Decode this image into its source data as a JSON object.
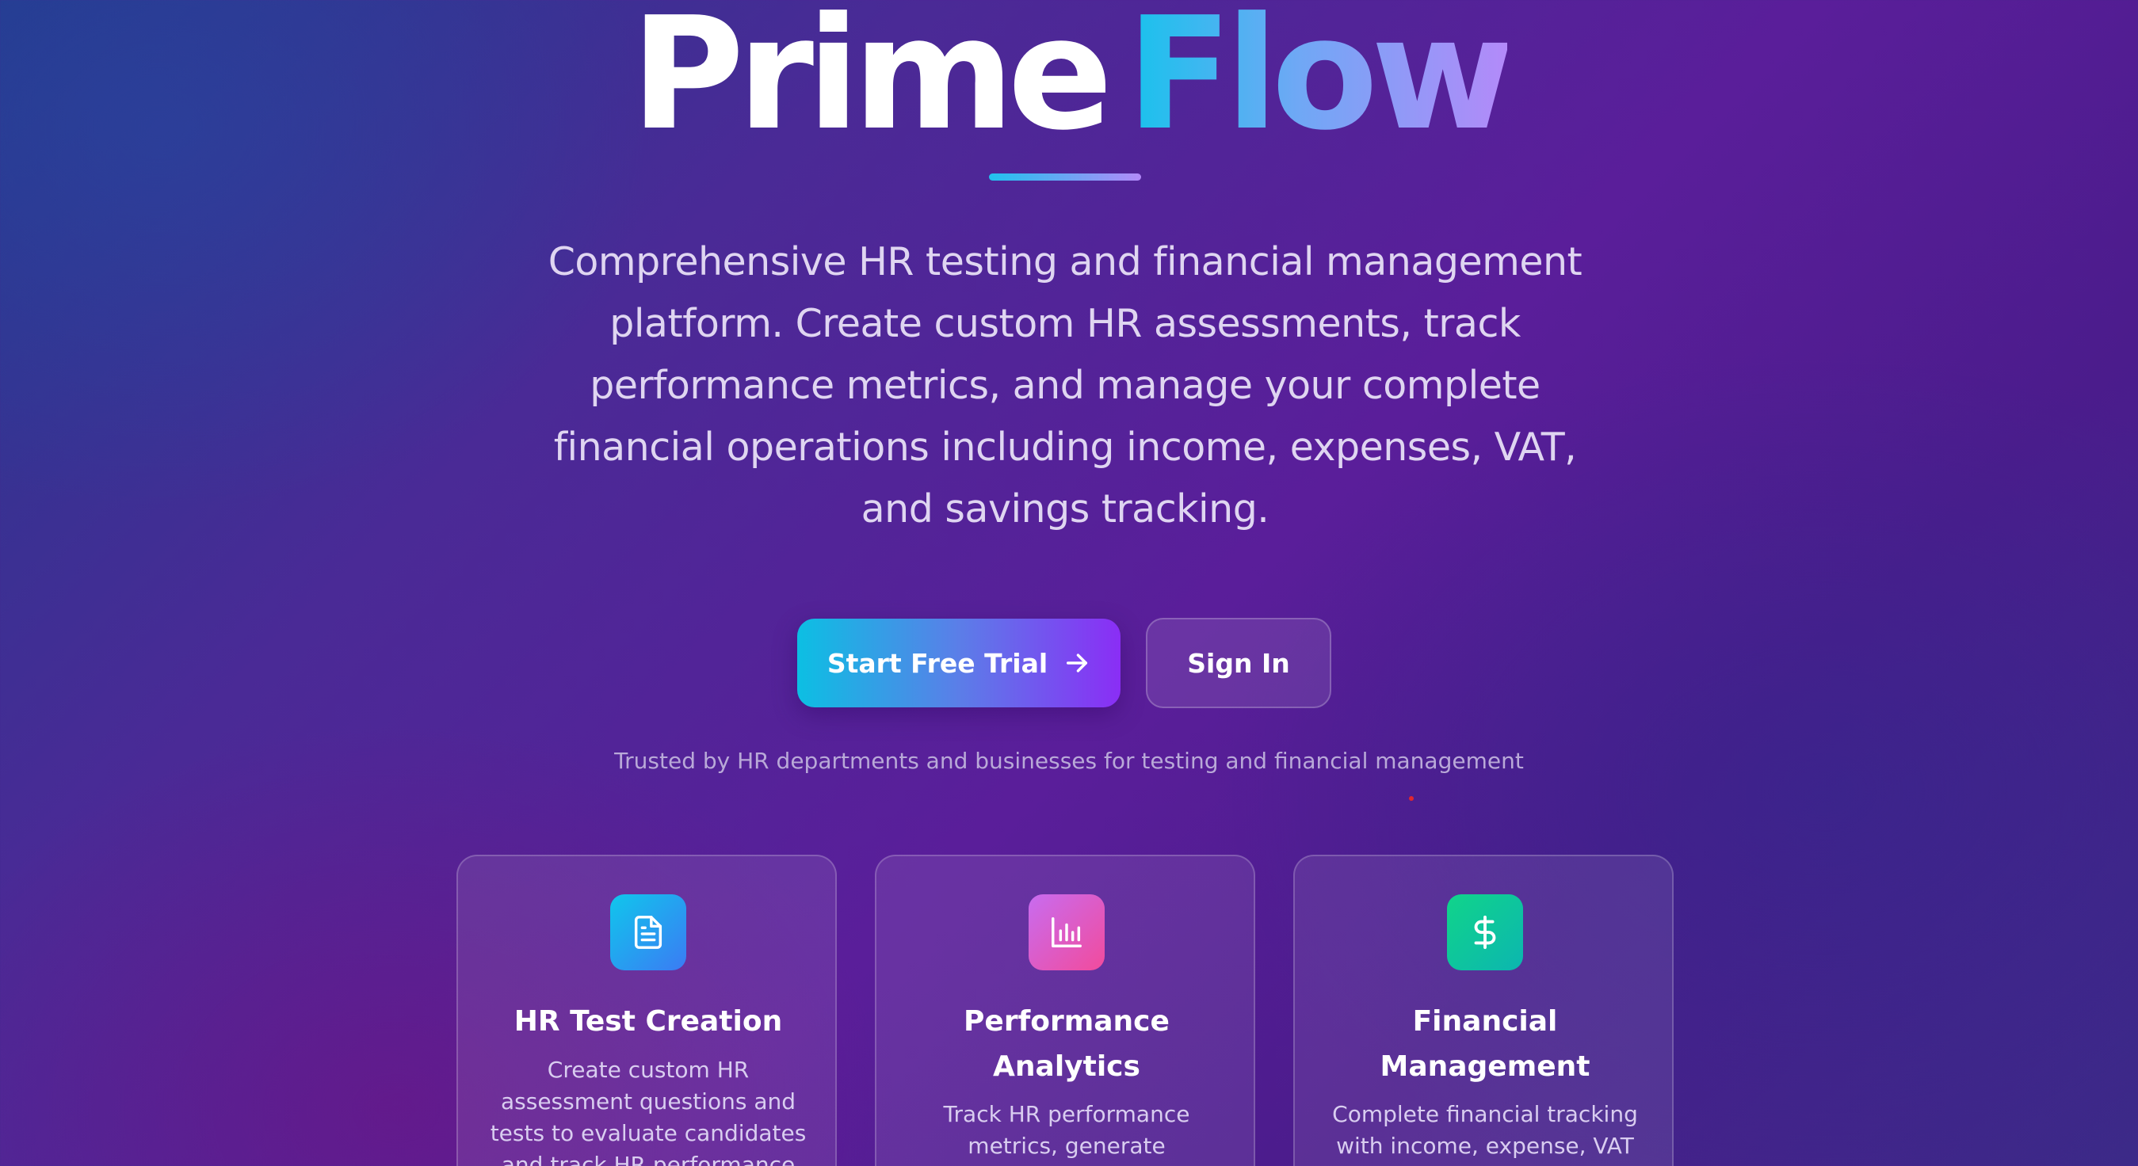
{
  "brand": {
    "word_1": "Prime",
    "word_2": "Flow"
  },
  "hero": {
    "tagline": "Comprehensive HR testing and financial management platform. Create custom HR assessments, track performance metrics, and manage your complete financial operations including income, expenses, VAT, and savings tracking."
  },
  "actions": {
    "primary_label": "Start Free Trial",
    "secondary_label": "Sign In"
  },
  "trusted_text": "Trusted by HR departments and businesses for testing and financial management",
  "features": [
    {
      "icon": "document-icon",
      "title": "HR Test Creation",
      "description": "Create custom HR assessment questions and tests to evaluate candidates and track HR performance"
    },
    {
      "icon": "bar-chart-icon",
      "title": "Performance Analytics",
      "description": "Track HR performance metrics, generate"
    },
    {
      "icon": "dollar-icon",
      "title": "Financial Management",
      "description": "Complete financial tracking with income, expense, VAT"
    }
  ],
  "colors": {
    "accent_cyan": "#16c3ec",
    "accent_purple": "#8a2ef5",
    "card_green": "#10d48a",
    "card_pink": "#f24b9c"
  }
}
